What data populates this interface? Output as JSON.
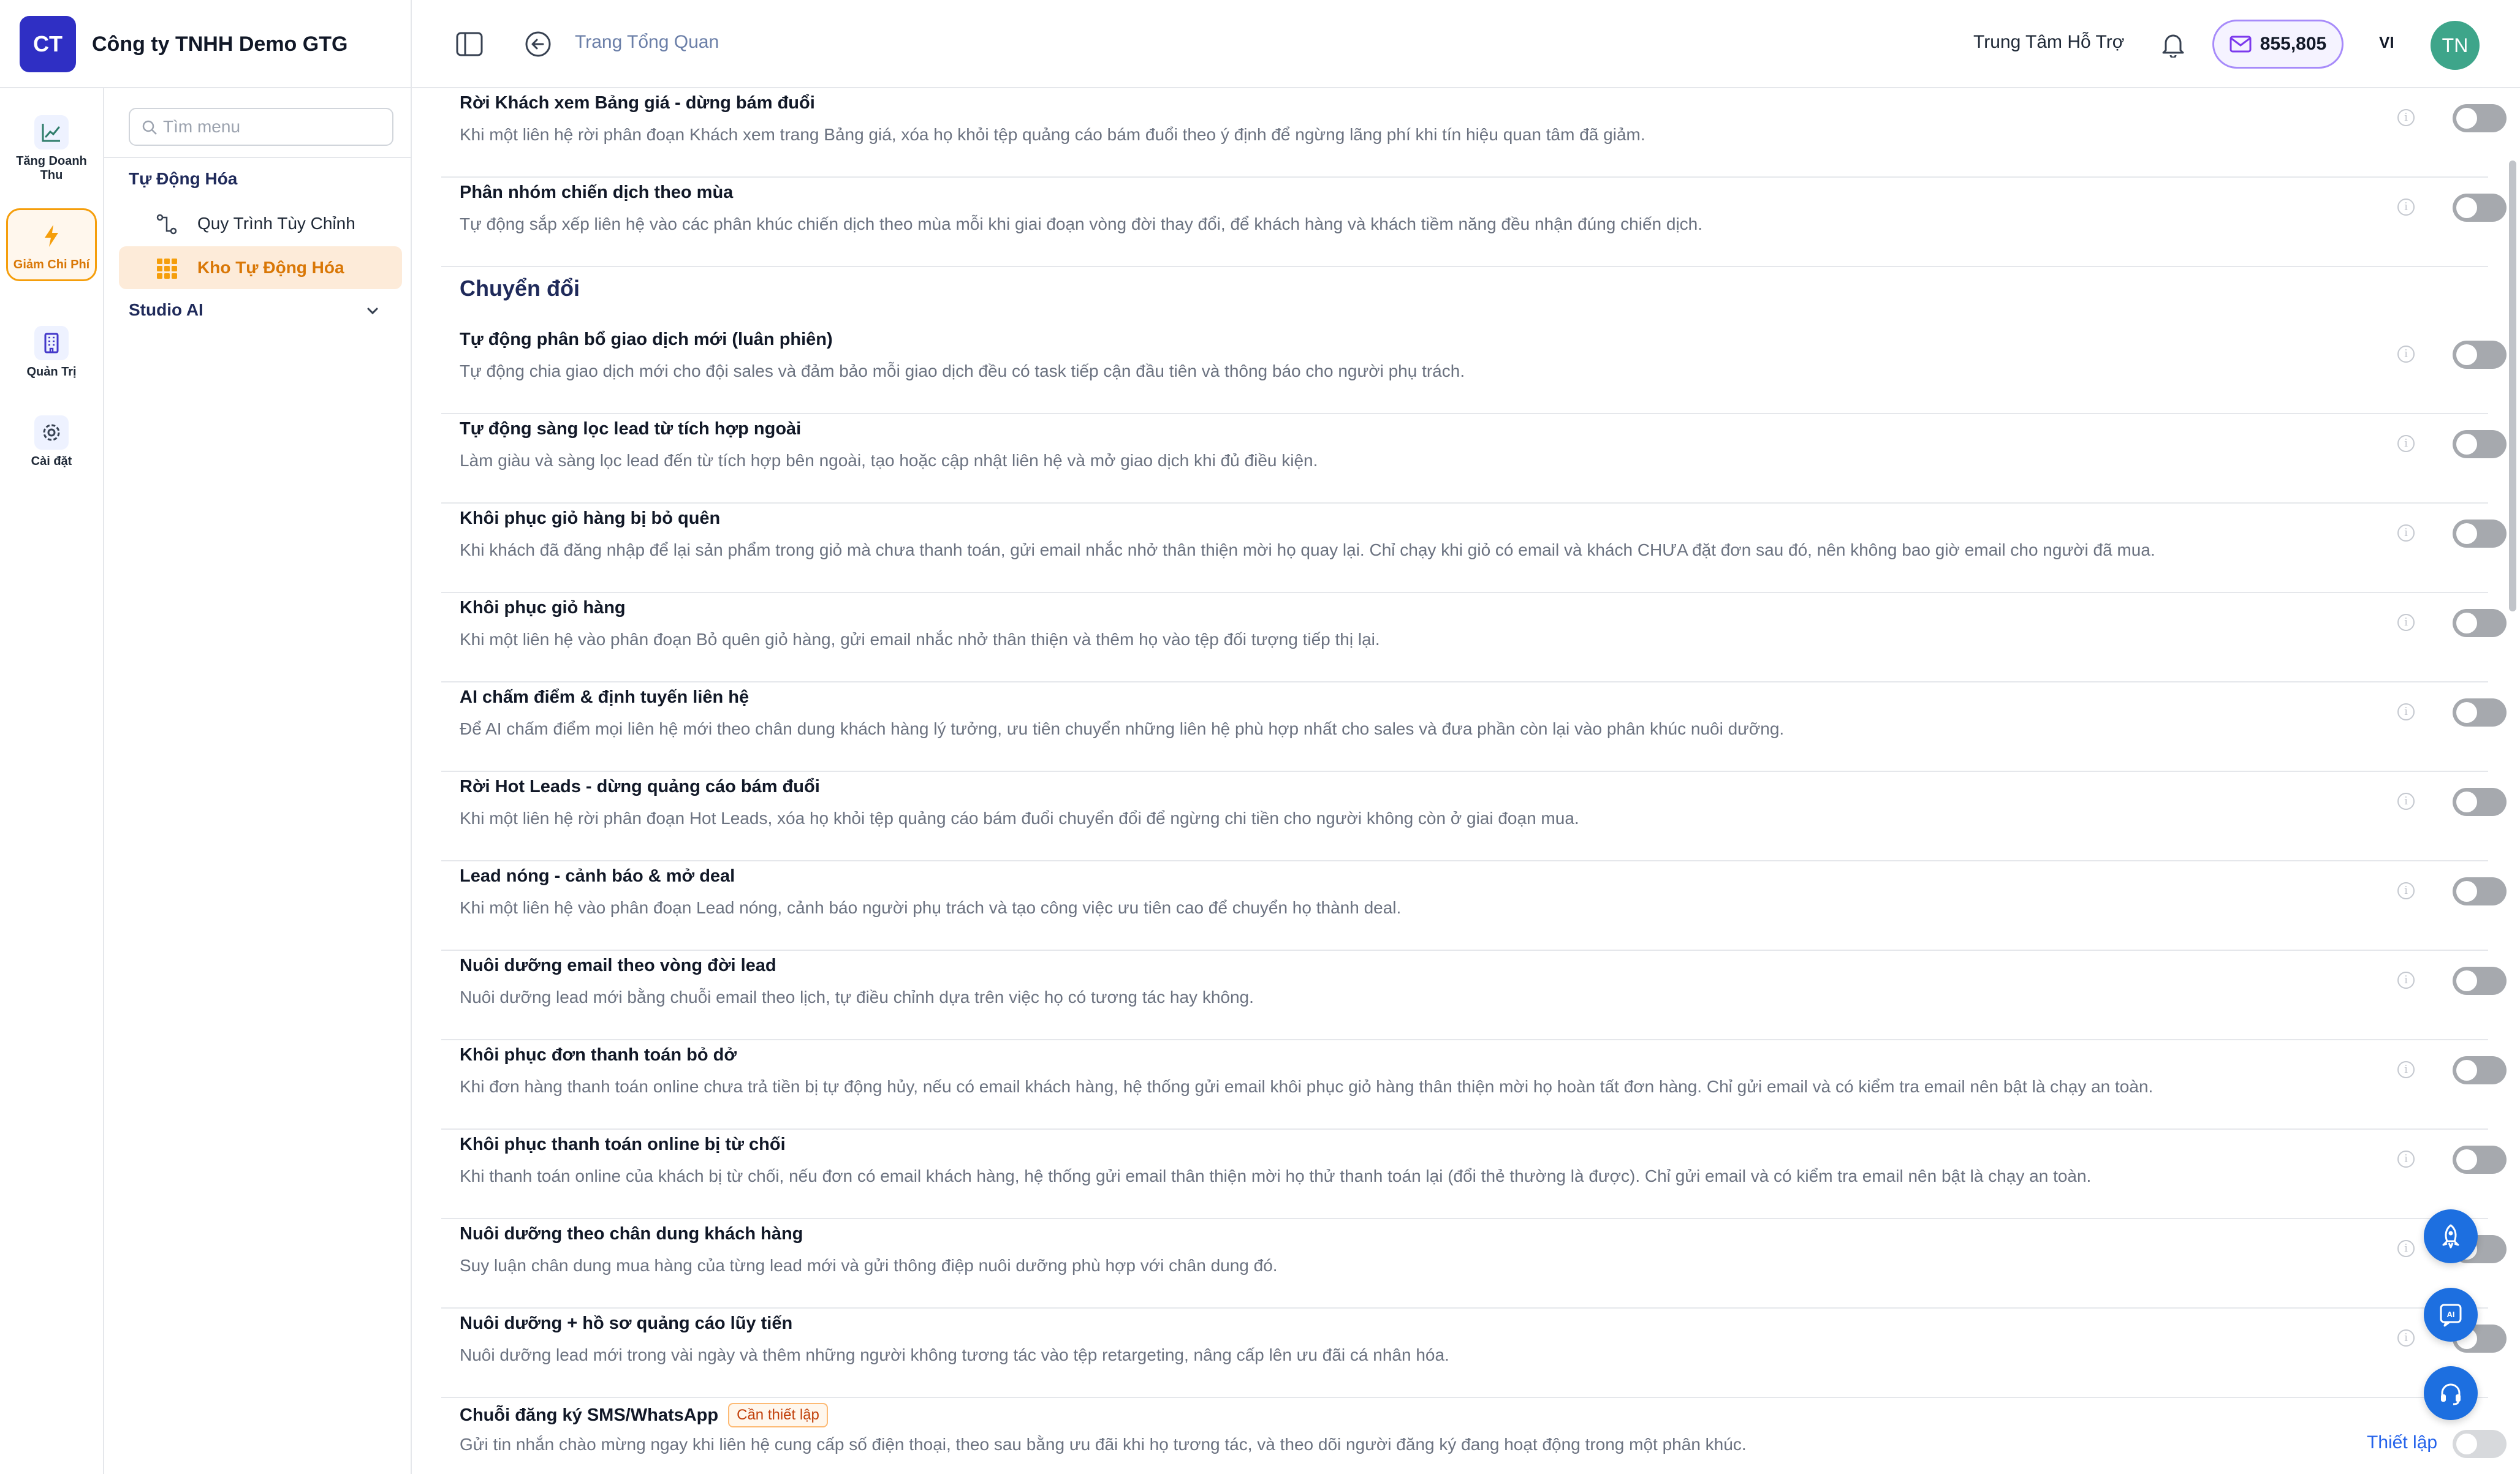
{
  "brand": {
    "logo_text": "CT",
    "company_name": "Công ty TNHH Demo GTG"
  },
  "header": {
    "breadcrumb": "Trang Tổng Quan",
    "support_label": "Trung Tâm Hỗ Trợ",
    "credits": "855,805",
    "language": "VI",
    "avatar_initials": "TN"
  },
  "rail": {
    "items": [
      {
        "label": "Tăng Doanh Thu",
        "icon": "chart-line-icon"
      },
      {
        "label": "Giảm Chi Phí",
        "icon": "lightning-icon",
        "active": true
      },
      {
        "label": "Quản Trị",
        "icon": "building-icon"
      },
      {
        "label": "Cài đặt",
        "icon": "gear-icon"
      }
    ]
  },
  "menu": {
    "search_placeholder": "Tìm menu",
    "group_automation": "Tự Động Hóa",
    "items": [
      {
        "label": "Quy Trình Tùy Chỉnh",
        "icon": "workflow-icon"
      },
      {
        "label": "Kho Tự Động Hóa",
        "icon": "grid-icon",
        "active": true
      }
    ],
    "studio_label": "Studio AI"
  },
  "main": {
    "top_rows": [
      {
        "title": "Rời Khách xem Bảng giá - dừng bám đuổi",
        "desc": "Khi một liên hệ rời phân đoạn Khách xem trang Bảng giá, xóa họ khỏi tệp quảng cáo bám đuổi theo ý định để ngừng lãng phí khi tín hiệu quan tâm đã giảm."
      },
      {
        "title": "Phân nhóm chiến dịch theo mùa",
        "desc": "Tự động sắp xếp liên hệ vào các phân khúc chiến dịch theo mùa mỗi khi giai đoạn vòng đời thay đổi, để khách hàng và khách tiềm năng đều nhận đúng chiến dịch."
      }
    ],
    "section_title": "Chuyển đổi",
    "rows": [
      {
        "title": "Tự động phân bổ giao dịch mới (luân phiên)",
        "desc": "Tự động chia giao dịch mới cho đội sales và đảm bảo mỗi giao dịch đều có task tiếp cận đầu tiên và thông báo cho người phụ trách."
      },
      {
        "title": "Tự động sàng lọc lead từ tích hợp ngoài",
        "desc": "Làm giàu và sàng lọc lead đến từ tích hợp bên ngoài, tạo hoặc cập nhật liên hệ và mở giao dịch khi đủ điều kiện."
      },
      {
        "title": "Khôi phục giỏ hàng bị bỏ quên",
        "desc": "Khi khách đã đăng nhập để lại sản phẩm trong giỏ mà chưa thanh toán, gửi email nhắc nhở thân thiện mời họ quay lại. Chỉ chạy khi giỏ có email và khách CHƯA đặt đơn sau đó, nên không bao giờ email cho người đã mua."
      },
      {
        "title": "Khôi phục giỏ hàng",
        "desc": "Khi một liên hệ vào phân đoạn Bỏ quên giỏ hàng, gửi email nhắc nhở thân thiện và thêm họ vào tệp đối tượng tiếp thị lại."
      },
      {
        "title": "AI chấm điểm & định tuyến liên hệ",
        "desc": "Để AI chấm điểm mọi liên hệ mới theo chân dung khách hàng lý tưởng, ưu tiên chuyển những liên hệ phù hợp nhất cho sales và đưa phần còn lại vào phân khúc nuôi dưỡng."
      },
      {
        "title": "Rời Hot Leads - dừng quảng cáo bám đuổi",
        "desc": "Khi một liên hệ rời phân đoạn Hot Leads, xóa họ khỏi tệp quảng cáo bám đuổi chuyển đổi để ngừng chi tiền cho người không còn ở giai đoạn mua."
      },
      {
        "title": "Lead nóng - cảnh báo & mở deal",
        "desc": "Khi một liên hệ vào phân đoạn Lead nóng, cảnh báo người phụ trách và tạo công việc ưu tiên cao để chuyển họ thành deal."
      },
      {
        "title": "Nuôi dưỡng email theo vòng đời lead",
        "desc": "Nuôi dưỡng lead mới bằng chuỗi email theo lịch, tự điều chỉnh dựa trên việc họ có tương tác hay không."
      },
      {
        "title": "Khôi phục đơn thanh toán bỏ dở",
        "desc": "Khi đơn hàng thanh toán online chưa trả tiền bị tự động hủy, nếu có email khách hàng, hệ thống gửi email khôi phục giỏ hàng thân thiện mời họ hoàn tất đơn hàng. Chỉ gửi email và có kiểm tra email nên bật là chạy an toàn."
      },
      {
        "title": "Khôi phục thanh toán online bị từ chối",
        "desc": "Khi thanh toán online của khách bị từ chối, nếu đơn có email khách hàng, hệ thống gửi email thân thiện mời họ thử thanh toán lại (đổi thẻ thường là được). Chỉ gửi email và có kiểm tra email nên bật là chạy an toàn."
      },
      {
        "title": "Nuôi dưỡng theo chân dung khách hàng",
        "desc": "Suy luận chân dung mua hàng của từng lead mới và gửi thông điệp nuôi dưỡng phù hợp với chân dung đó."
      },
      {
        "title": "Nuôi dưỡng + hồ sơ quảng cáo lũy tiến",
        "desc": "Nuôi dưỡng lead mới trong vài ngày và thêm những người không tương tác vào tệp retargeting, nâng cấp lên ưu đãi cá nhân hóa."
      },
      {
        "title": "Chuỗi đăng ký SMS/WhatsApp",
        "badge": "Cần thiết lập",
        "action": "Thiết lập",
        "desc": "Gửi tin nhắn chào mừng ngay khi liên hệ cung cấp số điện thoại, theo sau bằng ưu đãi khi họ tương tác, và theo dõi người đăng ký đang hoạt động trong một phân khúc."
      }
    ]
  },
  "colors": {
    "brand": "#2f2fc4",
    "accent_orange": "#d97706",
    "link_blue": "#2563eb",
    "fab_blue": "#1d6fe0"
  }
}
